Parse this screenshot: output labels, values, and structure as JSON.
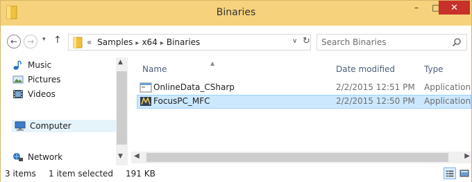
{
  "window": {
    "title": "Binaries"
  },
  "titlebar": {
    "minimize": "–",
    "maximize": "□",
    "close": "✕"
  },
  "nav": {
    "back": "←",
    "forward": "→",
    "recent": "▾",
    "up": "↑",
    "overflow": "«",
    "breadcrumbs": [
      "Samples",
      "x64",
      "Binaries"
    ],
    "sep": "▸",
    "dropdown": "∨",
    "refresh": "↻"
  },
  "search": {
    "placeholder": "Search Binaries"
  },
  "sidebar": {
    "items": [
      {
        "label": "Music",
        "icon": "music-icon"
      },
      {
        "label": "Pictures",
        "icon": "pictures-icon"
      },
      {
        "label": "Videos",
        "icon": "videos-icon"
      },
      {
        "label": "Computer",
        "icon": "computer-icon",
        "selected": true
      },
      {
        "label": "Network",
        "icon": "network-icon"
      }
    ]
  },
  "columns": {
    "name": "Name",
    "date": "Date modified",
    "type": "Type"
  },
  "files": [
    {
      "name": "OnlineData_CSharp",
      "date": "2/2/2015 12:51 PM",
      "type": "Application",
      "icon": "application-icon",
      "selected": false
    },
    {
      "name": "FocusPC_MFC",
      "date": "2/2/2015 12:50 PM",
      "type": "Application",
      "icon": "mfc-app-icon",
      "selected": true
    }
  ],
  "status": {
    "items": "3 items",
    "selected": "1 item selected",
    "size": "191 KB"
  },
  "colors": {
    "titlebar": "#f6d27c",
    "selection": "#cce8ff",
    "close": "#c7312a"
  }
}
